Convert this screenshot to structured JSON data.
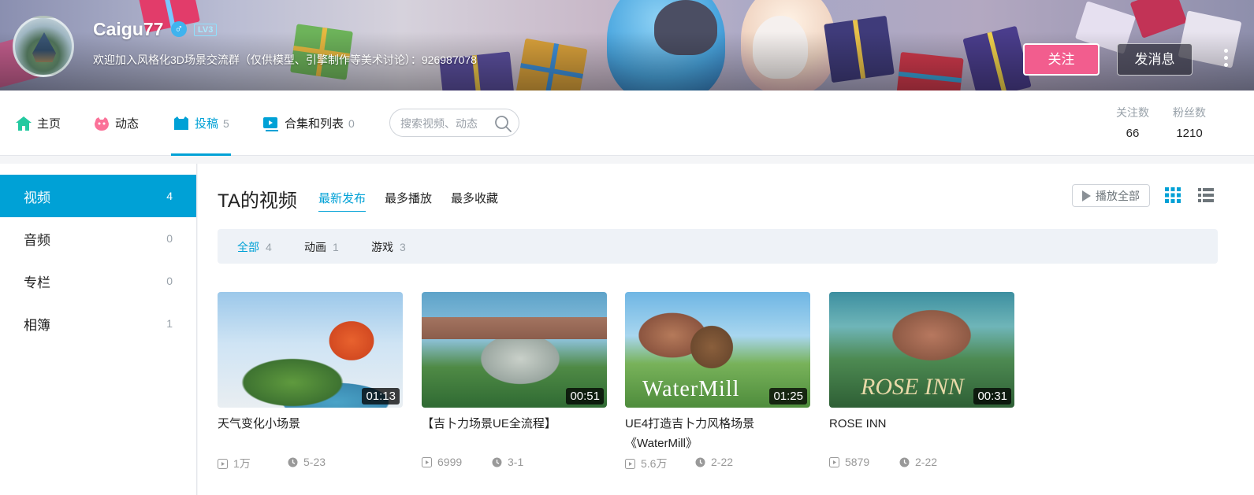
{
  "profile": {
    "username": "Caigu77",
    "gender_symbol": "♂",
    "level": "LV3",
    "signature": "欢迎加入风格化3D场景交流群（仅供模型、引擎制作等美术讨论）：926987078",
    "follow_label": "关注",
    "message_label": "发消息"
  },
  "nav": {
    "items": [
      {
        "label": "主页",
        "count": "",
        "icon": "home-icon"
      },
      {
        "label": "动态",
        "count": "",
        "icon": "dynamic-icon"
      },
      {
        "label": "投稿",
        "count": "5",
        "icon": "upload-icon",
        "active": true
      },
      {
        "label": "合集和列表",
        "count": "0",
        "icon": "collection-icon"
      }
    ],
    "search_placeholder": "搜索视频、动态"
  },
  "stats": {
    "following_label": "关注数",
    "following": "66",
    "fans_label": "粉丝数",
    "fans": "1210"
  },
  "sidebar": {
    "items": [
      {
        "label": "视频",
        "count": "4",
        "active": true
      },
      {
        "label": "音频",
        "count": "0"
      },
      {
        "label": "专栏",
        "count": "0"
      },
      {
        "label": "相簿",
        "count": "1"
      }
    ]
  },
  "main": {
    "title": "TA的视频",
    "sort_tabs": [
      "最新发布",
      "最多播放",
      "最多收藏"
    ],
    "play_all": "播放全部",
    "filters": [
      {
        "label": "全部",
        "count": "4",
        "active": true
      },
      {
        "label": "动画",
        "count": "1"
      },
      {
        "label": "游戏",
        "count": "3"
      }
    ],
    "videos": [
      {
        "title": "天气变化小场景",
        "duration": "01:13",
        "plays": "1万",
        "date": "5-23"
      },
      {
        "title": "【吉卜力场景UE全流程】",
        "duration": "00:51",
        "plays": "6999",
        "date": "3-1"
      },
      {
        "title": "UE4打造吉卜力风格场景《WaterMill》",
        "duration": "01:25",
        "plays": "5.6万",
        "date": "2-22",
        "overlay": "WaterMill"
      },
      {
        "title": "ROSE INN",
        "duration": "00:31",
        "plays": "5879",
        "date": "2-22",
        "overlay": "ROSE INN"
      }
    ]
  },
  "colors": {
    "accent": "#00a1d6",
    "follow": "#f25d8e"
  }
}
